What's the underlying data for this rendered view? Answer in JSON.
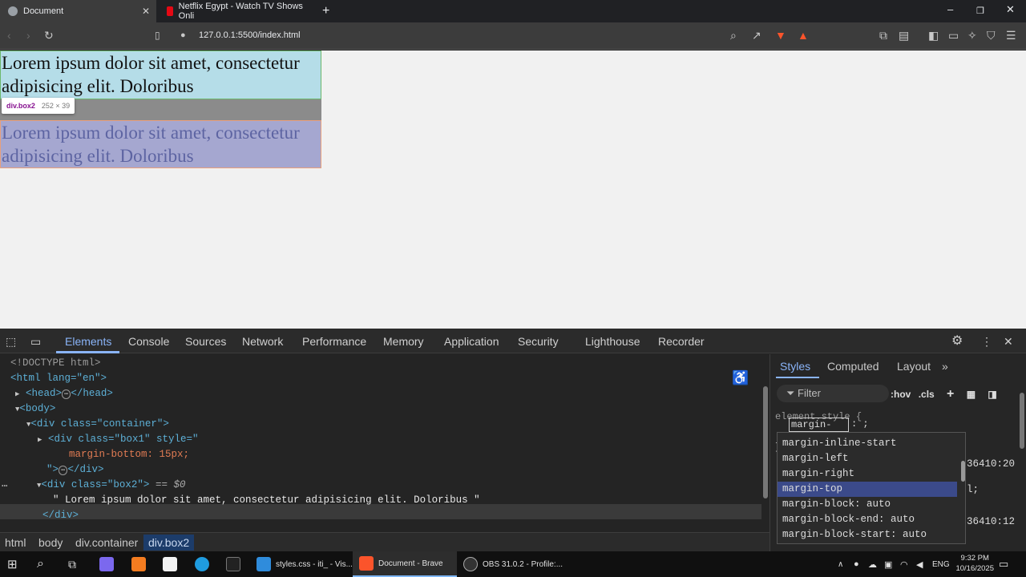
{
  "browser": {
    "tabs": [
      {
        "title": "Document",
        "active": true
      },
      {
        "title": "Netflix Egypt - Watch TV Shows Onli",
        "active": false
      }
    ],
    "new_tab": "+",
    "address": "127.0.0.1:5500/index.html",
    "window_controls": {
      "min": "–",
      "max": "❐",
      "close": "✕"
    }
  },
  "page": {
    "box1_text": "Lorem ipsum dolor sit amet, consectetur adipisicing elit. Doloribus",
    "box2_text": "Lorem ipsum dolor sit amet, consectetur adipisicing elit. Doloribus",
    "tooltip": {
      "selector": "div.box2",
      "size": "252 × 39"
    }
  },
  "devtools": {
    "tabs": [
      "Elements",
      "Console",
      "Sources",
      "Network",
      "Performance",
      "Memory",
      "Application",
      "Security",
      "Lighthouse",
      "Recorder"
    ],
    "dom": {
      "doctype": "<!DOCTYPE html>",
      "html_open": "<html lang=\"en\">",
      "head": "<head>",
      "head_close": "</head>",
      "body": "<body>",
      "container": "<div class=\"container\">",
      "box1_open": "<div class=\"box1\" style=\"",
      "box1_style": "margin-bottom: 15px;",
      "box1_close": "\">",
      "div_close": "</div>",
      "box2_open": "<div class=\"box2\">",
      "box2_marker": "== $0",
      "box2_text": "\" Lorem ipsum dolor sit amet, consectetur adipisicing elit. Doloribus \"",
      "box2_close": "</div>"
    },
    "breadcrumbs": [
      "html",
      "body",
      "div.container",
      "div.box2"
    ],
    "styles_tabs": [
      "Styles",
      "Computed",
      "Layout"
    ],
    "filter_placeholder": "Filter",
    "hov": ":hov",
    "cls": ".cls",
    "element_style": "element.style {",
    "edit_text": "margin-top",
    "edit_suffix": ": ;",
    "autocomplete": [
      "margin-inline-start",
      "margin-left",
      "margin-right",
      "margin-top",
      "margin-block: auto",
      "margin-block-end: auto",
      "margin-block-start: auto"
    ],
    "autocomplete_highlight": "margin-top",
    "peek": [
      "36410:20",
      "l;",
      "36410:12"
    ]
  },
  "taskbar": {
    "apps": [
      {
        "label": "styles.css - iti_ - Vis..."
      },
      {
        "label": "Document - Brave"
      },
      {
        "label": "OBS 31.0.2 - Profile:..."
      }
    ],
    "lang": "ENG",
    "time": "9:32 PM",
    "date": "10/16/2025"
  }
}
